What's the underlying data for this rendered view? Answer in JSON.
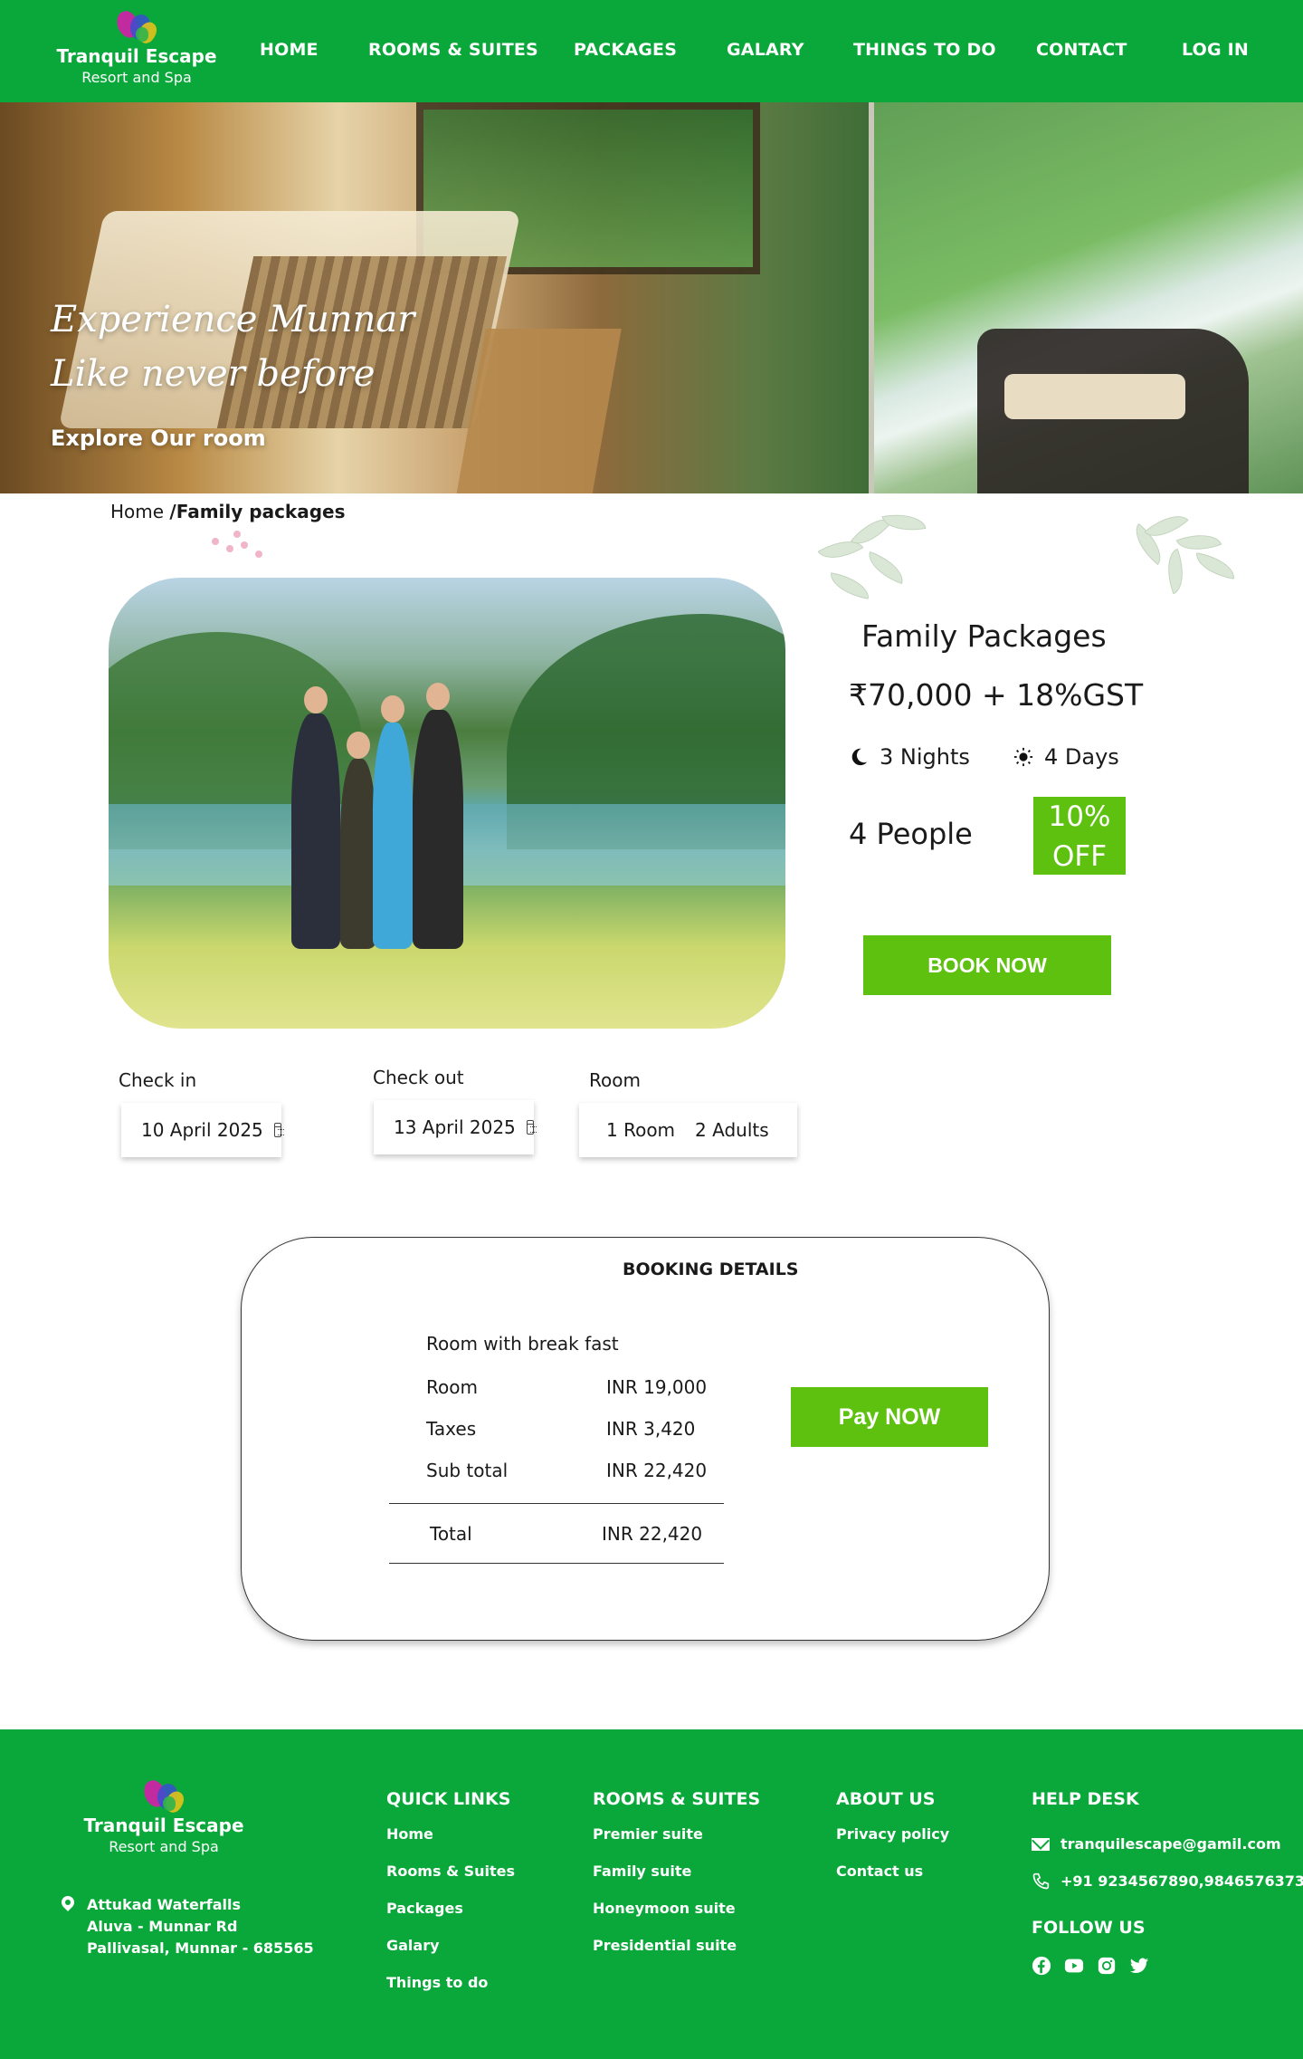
{
  "brand": {
    "name": "Tranquil Escape",
    "tagline": "Resort and Spa"
  },
  "nav": {
    "items": [
      "HOME",
      "ROOMS & SUITES",
      "PACKAGES",
      "GALARY",
      "THINGS TO DO",
      "CONTACT",
      "LOG IN"
    ]
  },
  "hero": {
    "title_line1": "Experience Munnar",
    "title_line2": "Like never before",
    "cta": "Explore Our room"
  },
  "breadcrumb": {
    "home": "Home",
    "current": "/Family packages"
  },
  "package": {
    "title": "Family Packages",
    "price": "₹70,000 + 18%GST",
    "nights": "3 Nights",
    "days": "4 Days",
    "people": "4 People",
    "discount_line1": "10%",
    "discount_line2": "OFF",
    "book_label": "BOOK NOW"
  },
  "form": {
    "checkin_label": "Check in",
    "checkin_value": "10 April 2025",
    "checkout_label": "Check out",
    "checkout_value": "13 April 2025",
    "room_label": "Room",
    "room_count": "1 Room",
    "guests": "2 Adults"
  },
  "booking": {
    "title": "BOOKING DETAILS",
    "subtitle": "Room with break fast",
    "rows": [
      {
        "label": "Room",
        "value": "INR 19,000"
      },
      {
        "label": "Taxes",
        "value": "INR 3,420"
      },
      {
        "label": "Sub total",
        "value": "INR 22,420"
      }
    ],
    "total_label": "Total",
    "total_value": "INR 22,420",
    "pay_label": "Pay NOW"
  },
  "footer": {
    "address": [
      "Attukad Waterfalls",
      "Aluva - Munnar Rd",
      "Pallivasal, Munnar - 685565"
    ],
    "quick_links": {
      "heading": "QUICK LINKS",
      "items": [
        "Home",
        "Rooms & Suites",
        "Packages",
        "Galary",
        "Things to do"
      ]
    },
    "rooms": {
      "heading": "ROOMS & SUITES",
      "items": [
        "Premier suite",
        "Family suite",
        "Honeymoon suite",
        "Presidential suite"
      ]
    },
    "about": {
      "heading": "ABOUT US",
      "items": [
        "Privacy policy",
        "Contact us"
      ]
    },
    "help": {
      "heading": "HELP DESK",
      "email": "tranquilescape@gamil.com",
      "phone": "+91 9234567890,9846576373"
    },
    "follow": {
      "heading": "FOLLOW US",
      "icons": [
        "facebook-icon",
        "youtube-icon",
        "instagram-icon",
        "twitter-icon"
      ]
    }
  },
  "colors": {
    "brand_green": "#0aa83a",
    "button_green": "#5ec10f",
    "white": "#ffffff"
  }
}
